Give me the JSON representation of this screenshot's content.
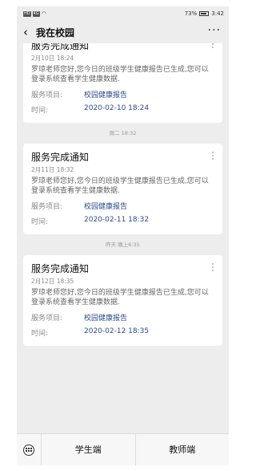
{
  "statusbar": {
    "left_chip_a": "HD",
    "left_chip_b": "4G",
    "battery": "73%",
    "time": "3:42"
  },
  "navbar": {
    "back_glyph": "‹",
    "title": "我在校园",
    "more_glyph": "···"
  },
  "cards": [
    {
      "title": "服务完成通知",
      "date": "2月10日 18:24",
      "body": "罗琼老师您好,您今日的班级学生健康报告已生成,您可以登录系统查看学生健康数据.",
      "service_label": "服务项目:",
      "service_value": "校园健康报告",
      "time_label": "时间:",
      "time_value": "2020-02-10 18:24"
    },
    {
      "title": "服务完成通知",
      "date": "2月11日 18:32",
      "body": "罗琼老师您好,您今日的班级学生健康报告已生成,您可以登录系统查看学生健康数据.",
      "service_label": "服务项目:",
      "service_value": "校园健康报告",
      "time_label": "时间:",
      "time_value": "2020-02-11 18:32"
    },
    {
      "title": "服务完成通知",
      "date": "2月12日 18:35",
      "body": "罗琼老师您好,您今日的班级学生健康报告已生成,您可以登录系统查看学生健康数据.",
      "service_label": "服务项目:",
      "service_value": "校园健康报告",
      "time_label": "时间:",
      "time_value": "2020-02-12 18:35"
    }
  ],
  "separators": [
    "周二 18:32",
    "昨天 晚上6:35"
  ],
  "tabbar": {
    "student": "学生端",
    "teacher": "教师端"
  }
}
